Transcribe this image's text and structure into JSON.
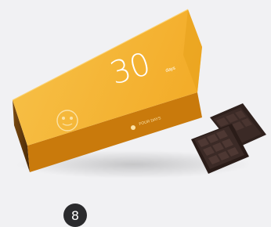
{
  "product": {
    "box_number": "30",
    "box_number_suffix": "days",
    "brand_text": "FOUR DAYS",
    "box_color": "#f2b431",
    "chocolate_color": "#3b2a26"
  },
  "pagination": {
    "current_page": "8"
  }
}
